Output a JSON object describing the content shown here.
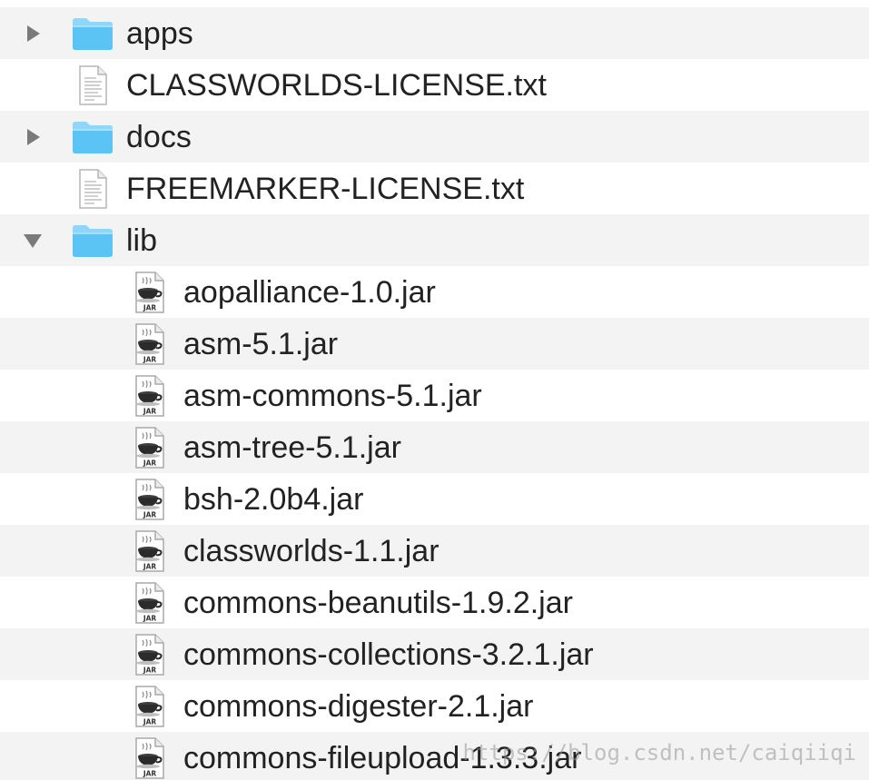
{
  "colors": {
    "folder_body": "#5cc3f5",
    "folder_tab": "#8fd6f8",
    "stripe": "#f3f3f3",
    "disclosure": "#7a7a7a",
    "text": "#222222"
  },
  "items": [
    {
      "name": "apps",
      "kind": "folder",
      "expanded": false,
      "icon": "folder-icon"
    },
    {
      "name": "CLASSWORLDS-LICENSE.txt",
      "kind": "text-file",
      "icon": "text-document-icon"
    },
    {
      "name": "docs",
      "kind": "folder",
      "expanded": false,
      "icon": "folder-icon"
    },
    {
      "name": "FREEMARKER-LICENSE.txt",
      "kind": "text-file",
      "icon": "text-document-icon"
    },
    {
      "name": "lib",
      "kind": "folder",
      "expanded": true,
      "icon": "folder-icon"
    }
  ],
  "lib_children": [
    {
      "name": "aopalliance-1.0.jar",
      "icon": "jar-file-icon",
      "badge": "JAR"
    },
    {
      "name": "asm-5.1.jar",
      "icon": "jar-file-icon",
      "badge": "JAR"
    },
    {
      "name": "asm-commons-5.1.jar",
      "icon": "jar-file-icon",
      "badge": "JAR"
    },
    {
      "name": "asm-tree-5.1.jar",
      "icon": "jar-file-icon",
      "badge": "JAR"
    },
    {
      "name": "bsh-2.0b4.jar",
      "icon": "jar-file-icon",
      "badge": "JAR"
    },
    {
      "name": "classworlds-1.1.jar",
      "icon": "jar-file-icon",
      "badge": "JAR"
    },
    {
      "name": "commons-beanutils-1.9.2.jar",
      "icon": "jar-file-icon",
      "badge": "JAR"
    },
    {
      "name": "commons-collections-3.2.1.jar",
      "icon": "jar-file-icon",
      "badge": "JAR"
    },
    {
      "name": "commons-digester-2.1.jar",
      "icon": "jar-file-icon",
      "badge": "JAR"
    },
    {
      "name": "commons-fileupload-1.3.3.jar",
      "icon": "jar-file-icon",
      "badge": "JAR"
    }
  ],
  "watermark": "https://blog.csdn.net/caiqiiqi"
}
